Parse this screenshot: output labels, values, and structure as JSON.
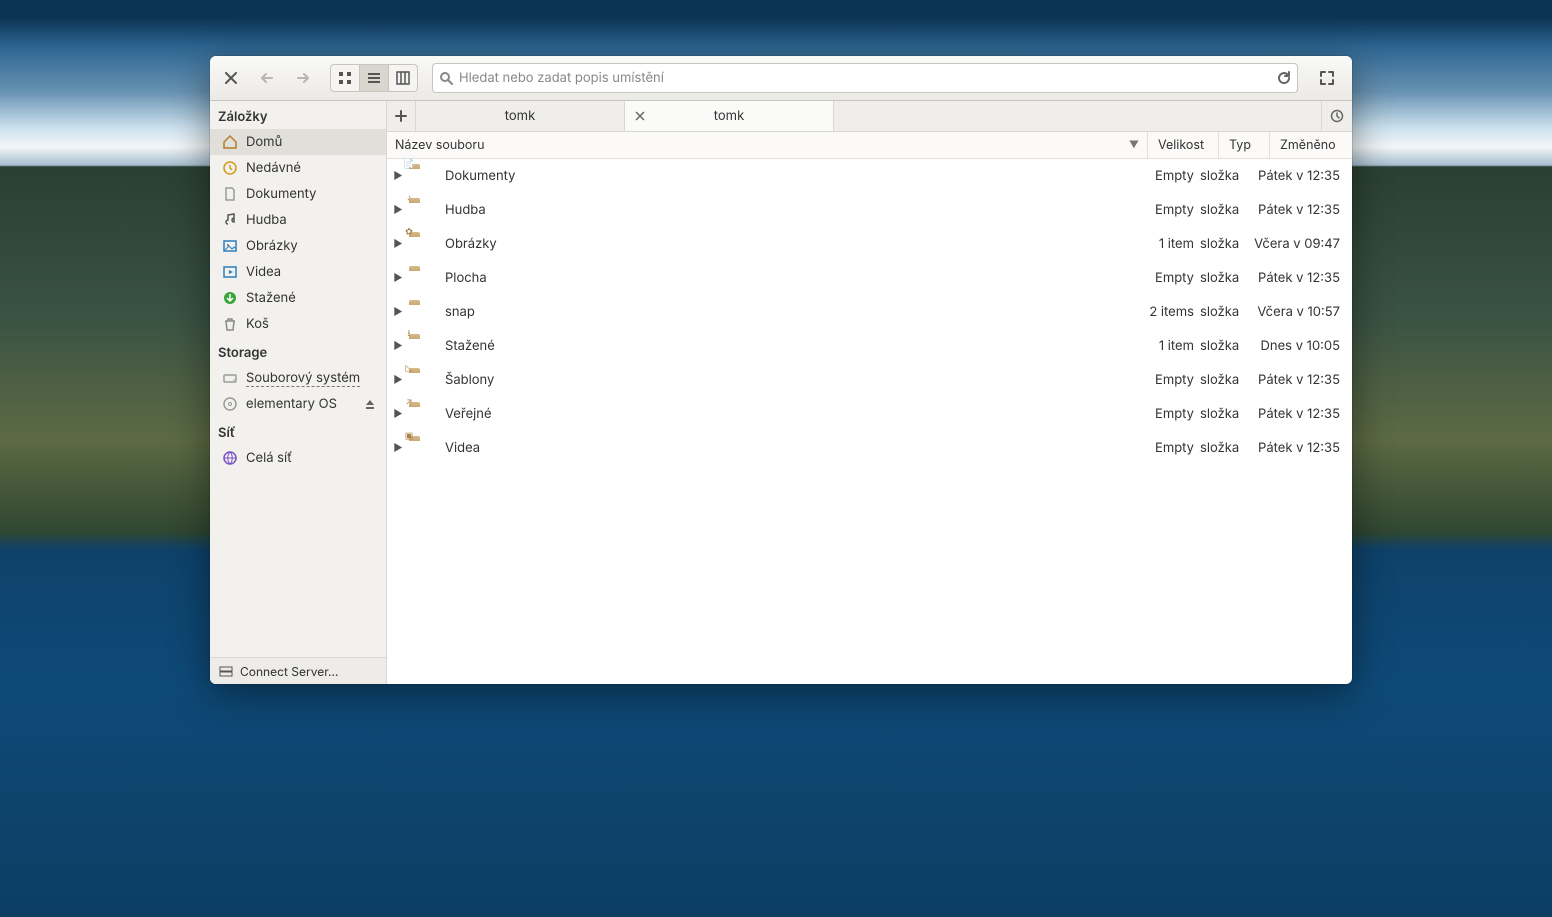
{
  "toolbar": {
    "search_placeholder": "Hledat nebo zadat popis umístění"
  },
  "tabs": [
    {
      "label": "tomk",
      "active": false,
      "closeable": false
    },
    {
      "label": "tomk",
      "active": true,
      "closeable": true
    }
  ],
  "columns": {
    "name": "Název souboru",
    "size": "Velikost",
    "type": "Typ",
    "modified": "Změněno"
  },
  "sidebar": {
    "bookmarks_heading": "Záložky",
    "storage_heading": "Storage",
    "network_heading": "Síť",
    "connect_server": "Connect Server…",
    "bookmarks": [
      {
        "name": "Domů",
        "icon": "home",
        "selected": true
      },
      {
        "name": "Nedávné",
        "icon": "recent",
        "selected": false
      },
      {
        "name": "Dokumenty",
        "icon": "doc",
        "selected": false
      },
      {
        "name": "Hudba",
        "icon": "music",
        "selected": false
      },
      {
        "name": "Obrázky",
        "icon": "pic",
        "selected": false
      },
      {
        "name": "Videa",
        "icon": "vid",
        "selected": false
      },
      {
        "name": "Stažené",
        "icon": "dl",
        "selected": false
      },
      {
        "name": "Koš",
        "icon": "trash",
        "selected": false
      }
    ],
    "storage": [
      {
        "name": "Souborový systém",
        "icon": "drive",
        "eject": false,
        "dashed": true
      },
      {
        "name": "elementary OS",
        "icon": "cd",
        "eject": true,
        "dashed": false
      }
    ],
    "network": [
      {
        "name": "Celá síť",
        "icon": "net"
      }
    ]
  },
  "files": [
    {
      "name": "Dokumenty",
      "glyph": "📄",
      "size": "Empty",
      "type": "složka",
      "modified": "Pátek v 12:35"
    },
    {
      "name": "Hudba",
      "glyph": "♪",
      "size": "Empty",
      "type": "složka",
      "modified": "Pátek v 12:35"
    },
    {
      "name": "Obrázky",
      "glyph": "✿",
      "size": "1 item",
      "type": "složka",
      "modified": "Včera v 09:47"
    },
    {
      "name": "Plocha",
      "glyph": "",
      "size": "Empty",
      "type": "složka",
      "modified": "Pátek v 12:35"
    },
    {
      "name": "snap",
      "glyph": "",
      "size": "2 items",
      "type": "složka",
      "modified": "Včera v 10:57"
    },
    {
      "name": "Stažené",
      "glyph": "⭳",
      "size": "1 item",
      "type": "složka",
      "modified": "Dnes v 10:05"
    },
    {
      "name": "Šablony",
      "glyph": "◺",
      "size": "Empty",
      "type": "složka",
      "modified": "Pátek v 12:35"
    },
    {
      "name": "Veřejné",
      "glyph": "↗",
      "size": "Empty",
      "type": "složka",
      "modified": "Pátek v 12:35"
    },
    {
      "name": "Videa",
      "glyph": "▣",
      "size": "Empty",
      "type": "složka",
      "modified": "Pátek v 12:35"
    }
  ]
}
